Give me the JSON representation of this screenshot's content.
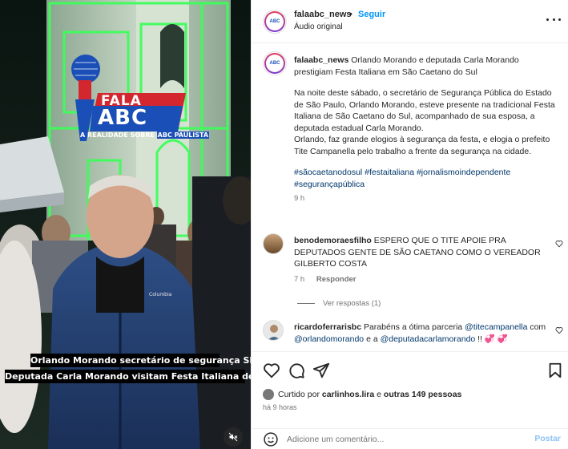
{
  "media": {
    "logo": {
      "word1": "FALA",
      "word2": "ABC",
      "tagline_prefix": "A REALIDADE SOBRE",
      "tagline_highlight": "ABC PAULISTA"
    },
    "overlay_caption_line1": "Orlando Morando secretário de segurança SP, e",
    "overlay_caption_line2": "Deputada Carla Morando visitam Festa Italiana de São Caetano",
    "jacket_brand": "Columbia",
    "mute_icon": "speaker-muted-icon"
  },
  "header": {
    "username": "falaabc_news",
    "separator": "•",
    "follow_label": "Seguir",
    "audio_label": "Áudio original",
    "more_icon": "more-options-icon"
  },
  "caption": {
    "username": "falaabc_news",
    "title": "Orlando Morando e deputada Carla Morando prestigiam Festa Italiana em São Caetano do Sul",
    "paragraph1": "Na noite deste sábado, o secretário de Segurança Pública do Estado de São Paulo, Orlando Morando, esteve presente na tradicional Festa Italiana de São Caetano do Sul, acompanhado de sua esposa, a deputada estadual Carla Morando.",
    "paragraph2": "Orlando, faz grande elogios à segurança da festa, e elogia o prefeito Tite Campanella pelo trabalho a frente da segurança na cidade.",
    "hashtags": "#sãocaetanodosul #festaitaliana #jornalismoindependente #segurançapública",
    "time": "9 h"
  },
  "comments": [
    {
      "username": "benodemoraesfilho",
      "text": "ESPERO QUE O TITE APOIE PRA DEPUTADOS GENTE DE SÃO CAETANO COMO O VEREADOR GILBERTO COSTA",
      "time": "7 h",
      "reply_label": "Responder",
      "view_replies": "Ver respostas (1)"
    },
    {
      "username": "ricardoferrarisbc",
      "text_before": "Parabéns a ótima parceria",
      "mention1": "@titecampanella",
      "text_com": "com",
      "mention2": "@orlandomorando",
      "text_and": "e a",
      "mention3": "@deputadacarlamorando",
      "text_end": "!! 💞 💞"
    }
  ],
  "actions": {
    "liked_by_prefix": "Curtido por",
    "liked_by_user": "carlinhos.lira",
    "liked_by_suffix": "e",
    "others": "outras 149 pessoas",
    "post_time": "há 9 horas"
  },
  "add_comment": {
    "placeholder": "Adicione um comentário...",
    "post_label": "Postar"
  },
  "colors": {
    "link_blue": "#0095f6",
    "mention_blue": "#00376b",
    "muted_text": "#737373",
    "border": "#efefef",
    "neon_green": "#3cff5a",
    "logo_red": "#d3262e",
    "logo_blue": "#1b4fb8"
  }
}
